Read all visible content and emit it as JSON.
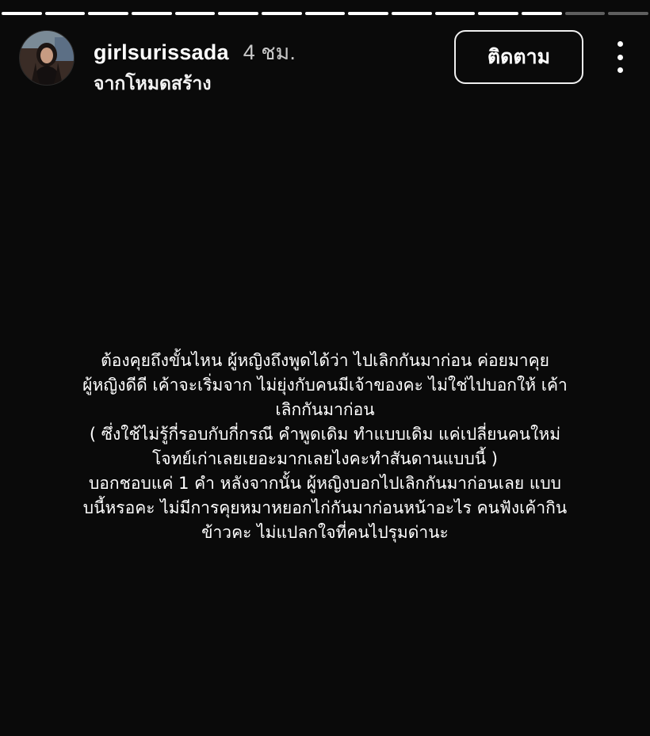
{
  "progress": {
    "total_segments": 15,
    "completed_segments": 13
  },
  "header": {
    "username": "girlsurissada",
    "time_ago": "4 ชม.",
    "subtitle": "จากโหมดสร้าง",
    "follow_label": "ติดตาม",
    "more_icon": "more-vertical-icon"
  },
  "story": {
    "lines": [
      "ต้องคุยถึงขั้นไหน  ผู้หญิงถึงพูดได้ว่า  ไปเลิกกันมาก่อน  ค่อยมาคุย",
      "ผู้หญิงดีดี  เค้าจะเริ่มจาก  ไม่ยุ่งกับคนมีเจ้าของคะ  ไม่ใช่ไปบอกให้  เค้า",
      "เลิกกันมาก่อน",
      "( ซึ่งใช้ไม่รู้กี่รอบกับกี่กรณี  คำพูดเดิม  ทำแบบเดิม  แค่เปลี่ยนคนใหม่",
      "โจทย์เก่าเลยเยอะมากเลยไงคะทำสันดานแบบนี้  )",
      "บอกชอบแค่  1  คำ  หลังจากนั้น  ผู้หญิงบอกไปเลิกกันมาก่อนเลย  แบบ",
      "บนี้หรอคะ  ไม่มีการคุยหมาหยอกไก่กันมาก่อนหน้าอะไร    คนฟังเค้ากิน",
      "ข้าวคะ  ไม่แปลกใจที่คนไปรุมด่านะ"
    ]
  },
  "colors": {
    "background": "#0a0a0a",
    "text": "#ffffff",
    "progress_done": "#ffffff",
    "progress_pending": "rgba(255,255,255,0.35)"
  }
}
